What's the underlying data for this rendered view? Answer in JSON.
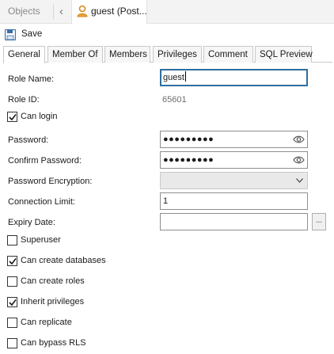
{
  "top_tabs": {
    "objects_label": "Objects",
    "back_glyph": "‹",
    "active_label": "guest (Post...",
    "active_icon": "user-role-icon"
  },
  "toolbar": {
    "save_label": "Save",
    "save_icon": "floppy-disk-icon"
  },
  "tabs": [
    {
      "label": "General",
      "active": true
    },
    {
      "label": "Member Of"
    },
    {
      "label": "Members"
    },
    {
      "label": "Privileges"
    },
    {
      "label": "Comment"
    },
    {
      "label": "SQL Preview"
    }
  ],
  "form": {
    "role_name": {
      "label": "Role Name:",
      "value": "guest"
    },
    "role_id": {
      "label": "Role ID:",
      "value": "65601"
    },
    "can_login": {
      "label": "Can login",
      "checked": true
    },
    "password": {
      "label": "Password:",
      "value": "●●●●●●●●●",
      "icon": "eye-icon"
    },
    "confirm_password": {
      "label": "Confirm Password:",
      "value": "●●●●●●●●●",
      "icon": "eye-icon"
    },
    "password_encryption": {
      "label": "Password Encryption:",
      "value": ""
    },
    "connection_limit": {
      "label": "Connection Limit:",
      "value": "1"
    },
    "expiry_date": {
      "label": "Expiry Date:",
      "value": "",
      "button_label": "..."
    }
  },
  "flags": [
    {
      "label": "Superuser",
      "checked": false
    },
    {
      "label": "Can create databases",
      "checked": true
    },
    {
      "label": "Can create roles",
      "checked": false
    },
    {
      "label": "Inherit privileges",
      "checked": true
    },
    {
      "label": "Can replicate",
      "checked": false
    },
    {
      "label": "Can bypass RLS",
      "checked": false
    }
  ],
  "colors": {
    "accent_user": "#e8a23a",
    "focus_border": "#2e6e9e",
    "save_icon": "#3b6ea5"
  }
}
